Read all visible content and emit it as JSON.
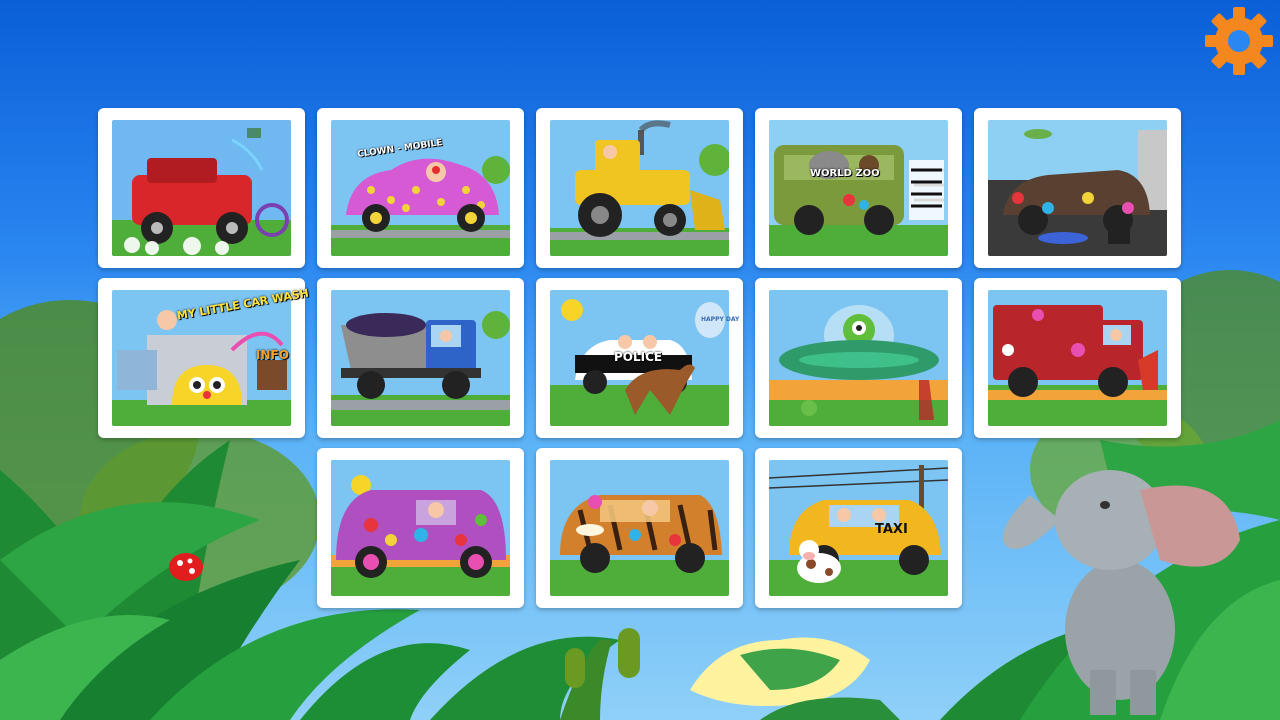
{
  "screen": "vehicle-select",
  "settings": {
    "icon": "gear-icon",
    "color": "#f4871e"
  },
  "cards": [
    {
      "id": "red-jeep",
      "body": "#d9262a",
      "theme": "wash",
      "label": ""
    },
    {
      "id": "clown-car",
      "body": "#d65ad4",
      "theme": "dots",
      "label": "CLOWN - MOBILE"
    },
    {
      "id": "bulldozer",
      "body": "#f1c521",
      "theme": "dozer",
      "label": ""
    },
    {
      "id": "safari-bus",
      "body": "#7a9a3c",
      "theme": "zoo",
      "label": "WORLD ZOO"
    },
    {
      "id": "muddy-car",
      "body": "#5a4030",
      "theme": "mud",
      "label": ""
    },
    {
      "id": "car-wash",
      "body": "#f6d428",
      "theme": "title",
      "label": "MY LITTLE CAR WASH",
      "sub": "INFO"
    },
    {
      "id": "dump-truck",
      "body": "#2e63c7",
      "theme": "truck",
      "label": ""
    },
    {
      "id": "police-car",
      "body": "#111111",
      "theme": "police",
      "label": "POLICE",
      "balloon": "HAPPY DAY"
    },
    {
      "id": "ufo",
      "body": "#2f9a6a",
      "theme": "ufo",
      "label": ""
    },
    {
      "id": "fire-truck",
      "body": "#b8252b",
      "theme": "fire",
      "label": ""
    },
    {
      "id": "flower-van",
      "body": "#b04fc0",
      "theme": "flower",
      "label": ""
    },
    {
      "id": "tiger-car",
      "body": "#d3802c",
      "theme": "tiger",
      "label": ""
    },
    {
      "id": "taxi",
      "body": "#f2b61f",
      "theme": "taxi",
      "label": "TAXI"
    }
  ]
}
